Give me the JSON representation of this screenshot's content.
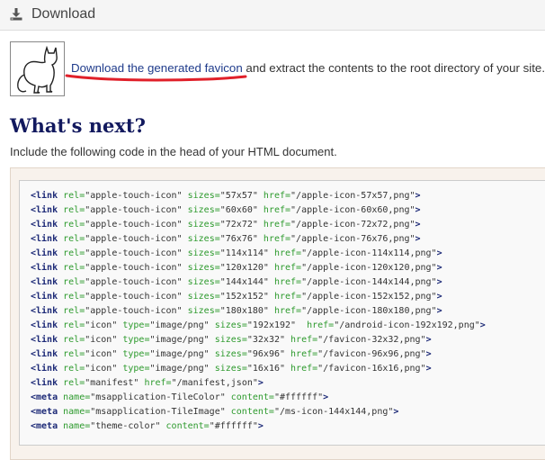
{
  "header": {
    "title": "Download",
    "icon": "download-icon"
  },
  "intro": {
    "link_text": "Download the generated favicon",
    "rest_text": " and extract the contents to the root directory of your site.",
    "image_icon": "cat-icon"
  },
  "section": {
    "heading": "What's next?",
    "subtitle": "Include the following code in the head of your HTML document."
  },
  "code_lines": [
    [
      {
        "t": "tag",
        "v": "<link"
      },
      {
        "t": "attr",
        "v": " rel="
      },
      {
        "t": "val",
        "v": "\"apple-touch-icon\""
      },
      {
        "t": "attr",
        "v": " sizes="
      },
      {
        "t": "val",
        "v": "\"57x57\""
      },
      {
        "t": "attr",
        "v": " href="
      },
      {
        "t": "val",
        "v": "\"/apple-icon-57x57,png\""
      },
      {
        "t": "tag",
        "v": ">"
      }
    ],
    [
      {
        "t": "tag",
        "v": "<link"
      },
      {
        "t": "attr",
        "v": " rel="
      },
      {
        "t": "val",
        "v": "\"apple-touch-icon\""
      },
      {
        "t": "attr",
        "v": " sizes="
      },
      {
        "t": "val",
        "v": "\"60x60\""
      },
      {
        "t": "attr",
        "v": " href="
      },
      {
        "t": "val",
        "v": "\"/apple-icon-60x60,png\""
      },
      {
        "t": "tag",
        "v": ">"
      }
    ],
    [
      {
        "t": "tag",
        "v": "<link"
      },
      {
        "t": "attr",
        "v": " rel="
      },
      {
        "t": "val",
        "v": "\"apple-touch-icon\""
      },
      {
        "t": "attr",
        "v": " sizes="
      },
      {
        "t": "val",
        "v": "\"72x72\""
      },
      {
        "t": "attr",
        "v": " href="
      },
      {
        "t": "val",
        "v": "\"/apple-icon-72x72,png\""
      },
      {
        "t": "tag",
        "v": ">"
      }
    ],
    [
      {
        "t": "tag",
        "v": "<link"
      },
      {
        "t": "attr",
        "v": " rel="
      },
      {
        "t": "val",
        "v": "\"apple-touch-icon\""
      },
      {
        "t": "attr",
        "v": " sizes="
      },
      {
        "t": "val",
        "v": "\"76x76\""
      },
      {
        "t": "attr",
        "v": " href="
      },
      {
        "t": "val",
        "v": "\"/apple-icon-76x76,png\""
      },
      {
        "t": "tag",
        "v": ">"
      }
    ],
    [
      {
        "t": "tag",
        "v": "<link"
      },
      {
        "t": "attr",
        "v": " rel="
      },
      {
        "t": "val",
        "v": "\"apple-touch-icon\""
      },
      {
        "t": "attr",
        "v": " sizes="
      },
      {
        "t": "val",
        "v": "\"114x114\""
      },
      {
        "t": "attr",
        "v": " href="
      },
      {
        "t": "val",
        "v": "\"/apple-icon-114x114,png\""
      },
      {
        "t": "tag",
        "v": ">"
      }
    ],
    [
      {
        "t": "tag",
        "v": "<link"
      },
      {
        "t": "attr",
        "v": " rel="
      },
      {
        "t": "val",
        "v": "\"apple-touch-icon\""
      },
      {
        "t": "attr",
        "v": " sizes="
      },
      {
        "t": "val",
        "v": "\"120x120\""
      },
      {
        "t": "attr",
        "v": " href="
      },
      {
        "t": "val",
        "v": "\"/apple-icon-120x120,png\""
      },
      {
        "t": "tag",
        "v": ">"
      }
    ],
    [
      {
        "t": "tag",
        "v": "<link"
      },
      {
        "t": "attr",
        "v": " rel="
      },
      {
        "t": "val",
        "v": "\"apple-touch-icon\""
      },
      {
        "t": "attr",
        "v": " sizes="
      },
      {
        "t": "val",
        "v": "\"144x144\""
      },
      {
        "t": "attr",
        "v": " href="
      },
      {
        "t": "val",
        "v": "\"/apple-icon-144x144,png\""
      },
      {
        "t": "tag",
        "v": ">"
      }
    ],
    [
      {
        "t": "tag",
        "v": "<link"
      },
      {
        "t": "attr",
        "v": " rel="
      },
      {
        "t": "val",
        "v": "\"apple-touch-icon\""
      },
      {
        "t": "attr",
        "v": " sizes="
      },
      {
        "t": "val",
        "v": "\"152x152\""
      },
      {
        "t": "attr",
        "v": " href="
      },
      {
        "t": "val",
        "v": "\"/apple-icon-152x152,png\""
      },
      {
        "t": "tag",
        "v": ">"
      }
    ],
    [
      {
        "t": "tag",
        "v": "<link"
      },
      {
        "t": "attr",
        "v": " rel="
      },
      {
        "t": "val",
        "v": "\"apple-touch-icon\""
      },
      {
        "t": "attr",
        "v": " sizes="
      },
      {
        "t": "val",
        "v": "\"180x180\""
      },
      {
        "t": "attr",
        "v": " href="
      },
      {
        "t": "val",
        "v": "\"/apple-icon-180x180,png\""
      },
      {
        "t": "tag",
        "v": ">"
      }
    ],
    [
      {
        "t": "tag",
        "v": "<link"
      },
      {
        "t": "attr",
        "v": " rel="
      },
      {
        "t": "val",
        "v": "\"icon\""
      },
      {
        "t": "attr",
        "v": " type="
      },
      {
        "t": "val",
        "v": "\"image/png\""
      },
      {
        "t": "attr",
        "v": " sizes="
      },
      {
        "t": "val",
        "v": "\"192x192\""
      },
      {
        "t": "attr",
        "v": "  href="
      },
      {
        "t": "val",
        "v": "\"/android-icon-192x192,png\""
      },
      {
        "t": "tag",
        "v": ">"
      }
    ],
    [
      {
        "t": "tag",
        "v": "<link"
      },
      {
        "t": "attr",
        "v": " rel="
      },
      {
        "t": "val",
        "v": "\"icon\""
      },
      {
        "t": "attr",
        "v": " type="
      },
      {
        "t": "val",
        "v": "\"image/png\""
      },
      {
        "t": "attr",
        "v": " sizes="
      },
      {
        "t": "val",
        "v": "\"32x32\""
      },
      {
        "t": "attr",
        "v": " href="
      },
      {
        "t": "val",
        "v": "\"/favicon-32x32,png\""
      },
      {
        "t": "tag",
        "v": ">"
      }
    ],
    [
      {
        "t": "tag",
        "v": "<link"
      },
      {
        "t": "attr",
        "v": " rel="
      },
      {
        "t": "val",
        "v": "\"icon\""
      },
      {
        "t": "attr",
        "v": " type="
      },
      {
        "t": "val",
        "v": "\"image/png\""
      },
      {
        "t": "attr",
        "v": " sizes="
      },
      {
        "t": "val",
        "v": "\"96x96\""
      },
      {
        "t": "attr",
        "v": " href="
      },
      {
        "t": "val",
        "v": "\"/favicon-96x96,png\""
      },
      {
        "t": "tag",
        "v": ">"
      }
    ],
    [
      {
        "t": "tag",
        "v": "<link"
      },
      {
        "t": "attr",
        "v": " rel="
      },
      {
        "t": "val",
        "v": "\"icon\""
      },
      {
        "t": "attr",
        "v": " type="
      },
      {
        "t": "val",
        "v": "\"image/png\""
      },
      {
        "t": "attr",
        "v": " sizes="
      },
      {
        "t": "val",
        "v": "\"16x16\""
      },
      {
        "t": "attr",
        "v": " href="
      },
      {
        "t": "val",
        "v": "\"/favicon-16x16,png\""
      },
      {
        "t": "tag",
        "v": ">"
      }
    ],
    [
      {
        "t": "tag",
        "v": "<link"
      },
      {
        "t": "attr",
        "v": " rel="
      },
      {
        "t": "val",
        "v": "\"manifest\""
      },
      {
        "t": "attr",
        "v": " href="
      },
      {
        "t": "val",
        "v": "\"/manifest,json\""
      },
      {
        "t": "tag",
        "v": ">"
      }
    ],
    [
      {
        "t": "tag",
        "v": "<meta"
      },
      {
        "t": "attr",
        "v": " name="
      },
      {
        "t": "val",
        "v": "\"msapplication-TileColor\""
      },
      {
        "t": "attr",
        "v": " content="
      },
      {
        "t": "val",
        "v": "\"#ffffff\""
      },
      {
        "t": "tag",
        "v": ">"
      }
    ],
    [
      {
        "t": "tag",
        "v": "<meta"
      },
      {
        "t": "attr",
        "v": " name="
      },
      {
        "t": "val",
        "v": "\"msapplication-TileImage\""
      },
      {
        "t": "attr",
        "v": " content="
      },
      {
        "t": "val",
        "v": "\"/ms-icon-144x144,png\""
      },
      {
        "t": "tag",
        "v": ">"
      }
    ],
    [
      {
        "t": "tag",
        "v": "<meta"
      },
      {
        "t": "attr",
        "v": " name="
      },
      {
        "t": "val",
        "v": "\"theme-color\""
      },
      {
        "t": "attr",
        "v": " content="
      },
      {
        "t": "val",
        "v": "\"#ffffff\""
      },
      {
        "t": "tag",
        "v": ">"
      }
    ]
  ],
  "colors": {
    "heading": "#12195e",
    "link": "#1f3b8b",
    "underline_annotation": "#e0202a",
    "code_tag": "#1d2a77",
    "code_attr": "#2d9a2d"
  }
}
